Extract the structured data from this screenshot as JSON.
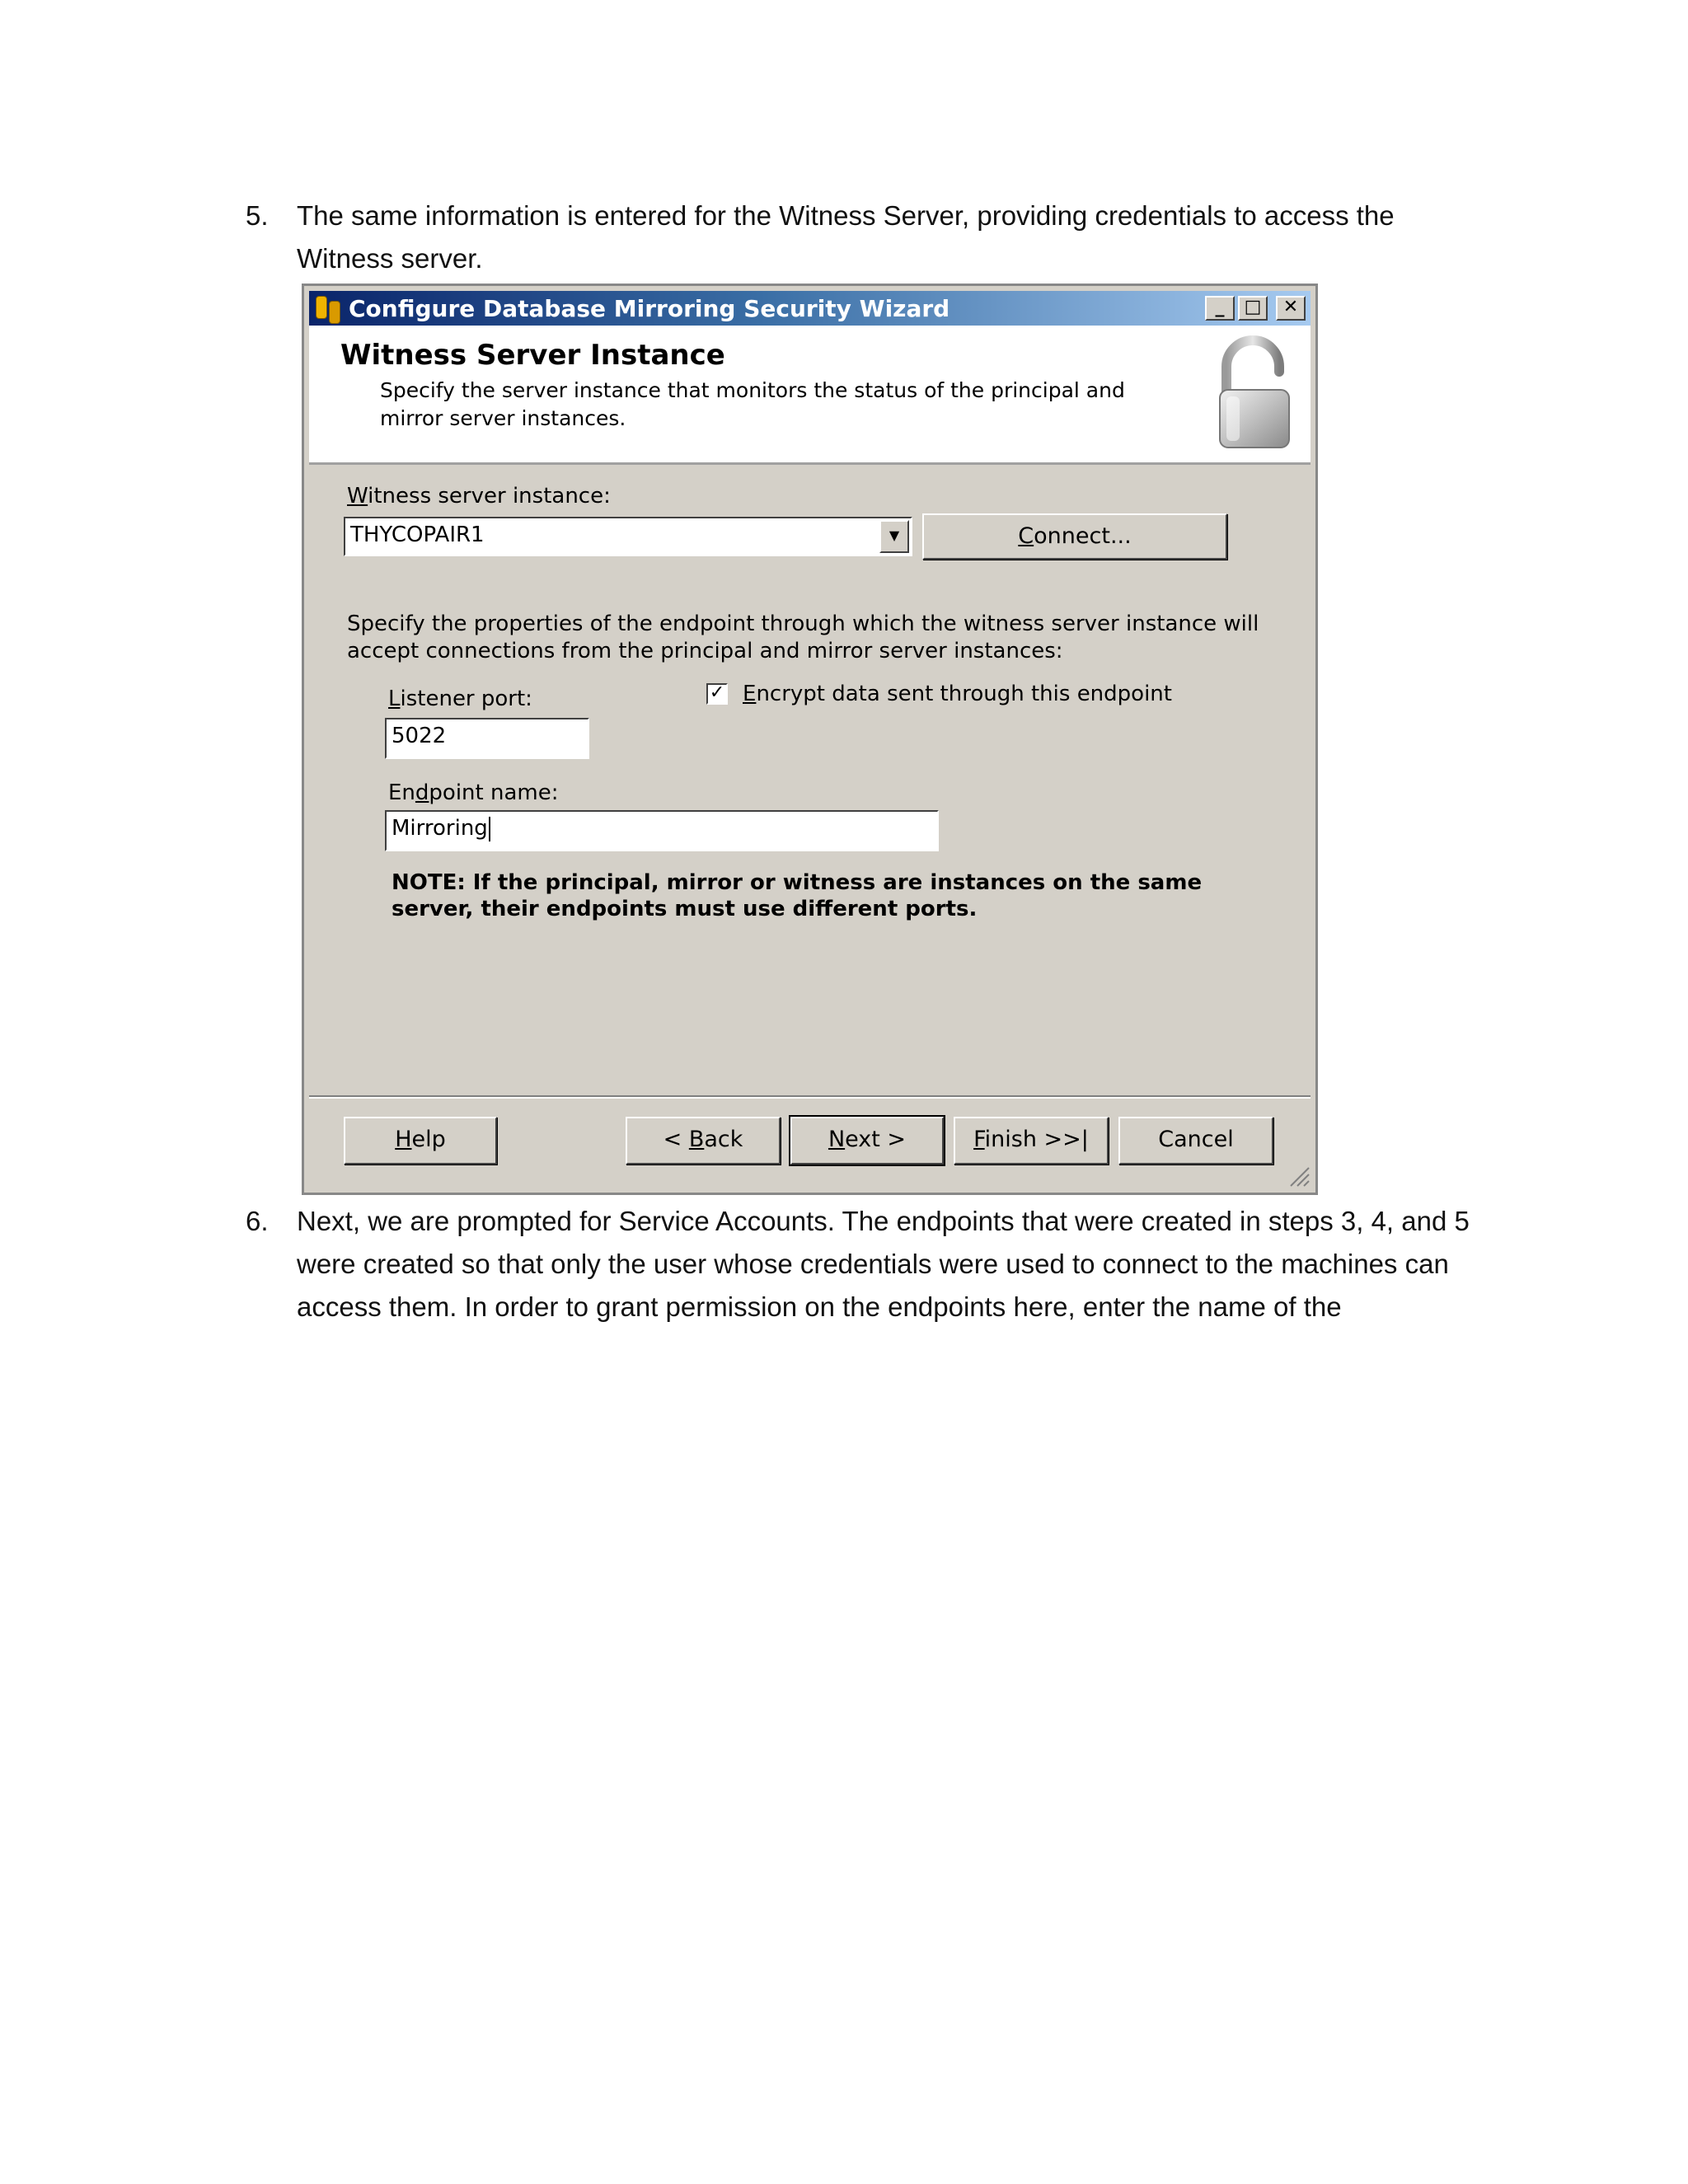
{
  "document": {
    "step5": {
      "number": "5.",
      "text": "The same information is entered for the Witness Server, providing credentials to access the Witness server."
    },
    "step6": {
      "number": "6.",
      "text": "Next, we are prompted for Service Accounts.  The endpoints that were created in steps 3, 4, and 5 were created so that only the user whose credentials were used to connect to the machines can access them.  In order to grant permission on the endpoints here, enter the name of the"
    }
  },
  "dialog": {
    "title": "Configure Database Mirroring Security Wizard",
    "title_buttons": {
      "minimize": "_",
      "maximize": "□",
      "close": "✕"
    },
    "header": {
      "title": "Witness Server Instance",
      "description": "Specify the server instance that monitors the status of the principal and mirror server instances."
    },
    "witness_label": {
      "accel": "W",
      "rest": "itness server instance:"
    },
    "witness_value": "THYCOPAIR1",
    "connect_button": {
      "accel": "C",
      "rest": "onnect..."
    },
    "endpoint_description": "Specify the properties of the endpoint through which the witness server instance will accept connections from the principal and mirror server instances:",
    "listener_label": {
      "accel": "L",
      "rest": "istener port:"
    },
    "listener_value": "5022",
    "encrypt_label": {
      "accel": "E",
      "rest": "ncrypt data sent through this endpoint"
    },
    "encrypt_checked": true,
    "endpoint_name_label": {
      "pre": "En",
      "accel": "d",
      "rest": "point name:"
    },
    "endpoint_name_value": "Mirroring",
    "note": "NOTE: If the principal, mirror or witness are instances on the same server, their endpoints must use different ports.",
    "buttons": {
      "help": {
        "accel": "H",
        "rest": "elp"
      },
      "back": {
        "pre": "< ",
        "accel": "B",
        "rest": "ack"
      },
      "next": {
        "accel": "N",
        "rest": "ext >"
      },
      "finish": {
        "accel": "F",
        "rest": "inish >>|"
      },
      "cancel": "Cancel"
    },
    "icons": {
      "app": "database-icon",
      "header": "padlock-icon",
      "combo": "chevron-down-icon",
      "grip": "resize-grip-icon"
    }
  }
}
